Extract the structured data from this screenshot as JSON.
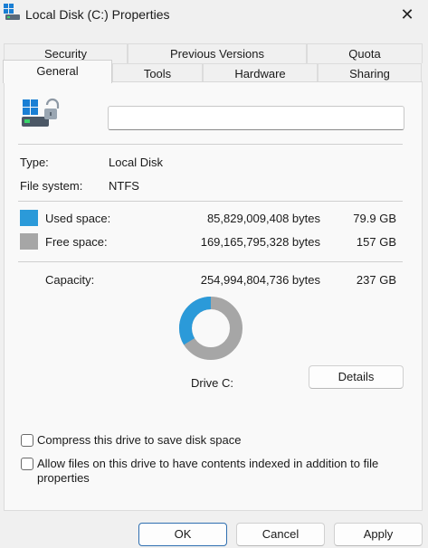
{
  "window": {
    "title": "Local Disk (C:) Properties",
    "close_glyph": "✕"
  },
  "tabs": {
    "row1": [
      {
        "label": "Security"
      },
      {
        "label": "Previous Versions"
      },
      {
        "label": "Quota"
      }
    ],
    "row2": [
      {
        "label": "General",
        "active": true
      },
      {
        "label": "Tools"
      },
      {
        "label": "Hardware"
      },
      {
        "label": "Sharing"
      }
    ]
  },
  "general": {
    "drive_name_value": "",
    "type_label": "Type:",
    "type_value": "Local Disk",
    "fs_label": "File system:",
    "fs_value": "NTFS",
    "used": {
      "label": "Used space:",
      "bytes": "85,829,009,408 bytes",
      "size": "79.9 GB",
      "color": "#2b9ad9"
    },
    "free": {
      "label": "Free space:",
      "bytes": "169,165,795,328 bytes",
      "size": "157 GB",
      "color": "#a6a6a6"
    },
    "capacity": {
      "label": "Capacity:",
      "bytes": "254,994,804,736 bytes",
      "size": "237 GB"
    },
    "used_fraction": 0.337,
    "drive_label": "Drive C:",
    "details_button": "Details",
    "compress_label": "Compress this drive to save disk space",
    "compress_checked": false,
    "index_label": "Allow files on this drive to have contents indexed in addition to file properties",
    "index_checked": false
  },
  "footer": {
    "ok": "OK",
    "cancel": "Cancel",
    "apply": "Apply"
  },
  "icons": {
    "title": "drive-windows-icon",
    "drive": "drive-windows-icon"
  }
}
